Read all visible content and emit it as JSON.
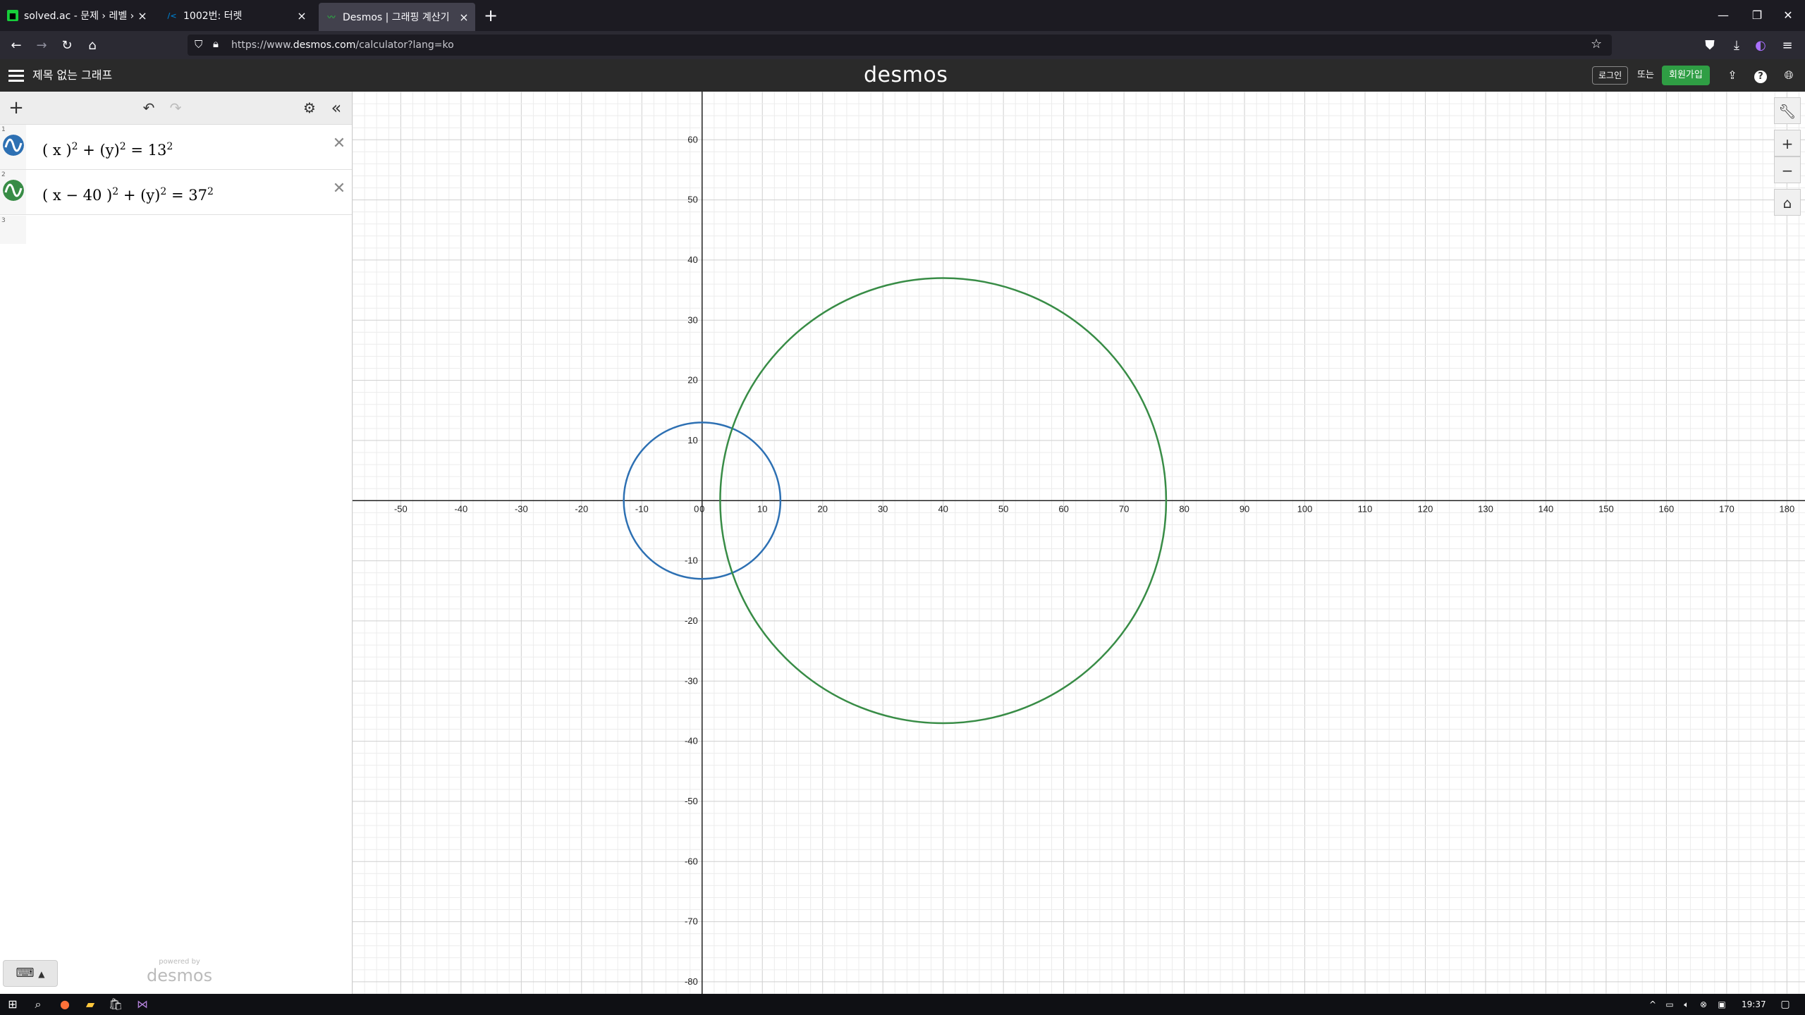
{
  "browser": {
    "tabs": [
      {
        "title": "solved.ac - 문제 › 레벨 › Bronz",
        "icon": "solvedac-icon",
        "active": false
      },
      {
        "title": "1002번: 터렛",
        "icon": "baekjoon-icon",
        "active": false
      },
      {
        "title": "Desmos | 그래핑 계산기",
        "icon": "desmos-icon",
        "active": true
      }
    ],
    "url_prefix": "https://www.",
    "url_domain": "desmos.com",
    "url_path": "/calculator?lang=ko"
  },
  "header": {
    "graph_title": "제목 없는 그래프",
    "logo": "desmos",
    "login_label": "로그인",
    "or_label": "또는",
    "signup_label": "회원가입"
  },
  "expressions": [
    {
      "number": "1",
      "color": "#2d70b3",
      "latex_parts": [
        "( x )",
        "2",
        " + (y)",
        "2",
        " = 13",
        "2"
      ]
    },
    {
      "number": "2",
      "color": "#388c46",
      "latex_parts": [
        "( x − 40 )",
        "2",
        " + (y)",
        "2",
        " = 37",
        "2"
      ]
    }
  ],
  "empty_row_number": "3",
  "powered_small": "powered by",
  "powered_big": "desmos",
  "chart_data": {
    "type": "scatter",
    "description_type": "graph",
    "x_ticks": [
      -50,
      -40,
      -30,
      -20,
      -10,
      0,
      10,
      20,
      30,
      40,
      50,
      60,
      70,
      80,
      90,
      100,
      110,
      120,
      130,
      140,
      150,
      160,
      170,
      180
    ],
    "y_ticks": [
      60,
      50,
      40,
      30,
      20,
      10,
      -10,
      -20,
      -30,
      -40,
      -50,
      -60,
      -70,
      -80
    ],
    "xlim": [
      -58,
      183
    ],
    "ylim": [
      -82,
      68
    ],
    "grid": true,
    "curves": [
      {
        "kind": "circle",
        "cx": 0,
        "cy": 0,
        "r": 13,
        "color": "#2d70b3"
      },
      {
        "kind": "circle",
        "cx": 40,
        "cy": 0,
        "r": 37,
        "color": "#388c46"
      }
    ]
  },
  "taskbar": {
    "clock": "19:37"
  }
}
